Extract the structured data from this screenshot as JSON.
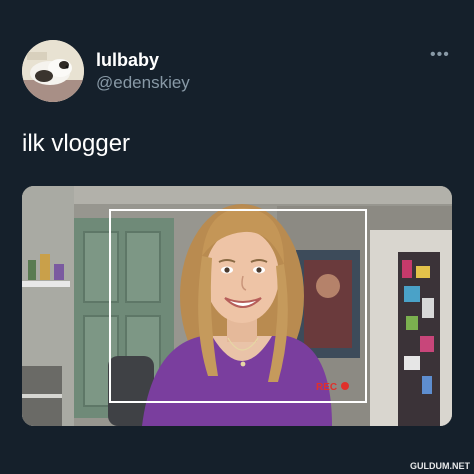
{
  "tweet": {
    "display_name": "lulbaby",
    "handle": "@edenskiey",
    "text": "ilk vlogger",
    "more_icon": "more-horizontal-icon"
  },
  "media": {
    "rec_label": "REC",
    "rec_color": "#e0302b"
  },
  "watermark": "GULDUM.NET",
  "colors": {
    "background": "#15202b",
    "secondary_text": "#8899a6"
  }
}
